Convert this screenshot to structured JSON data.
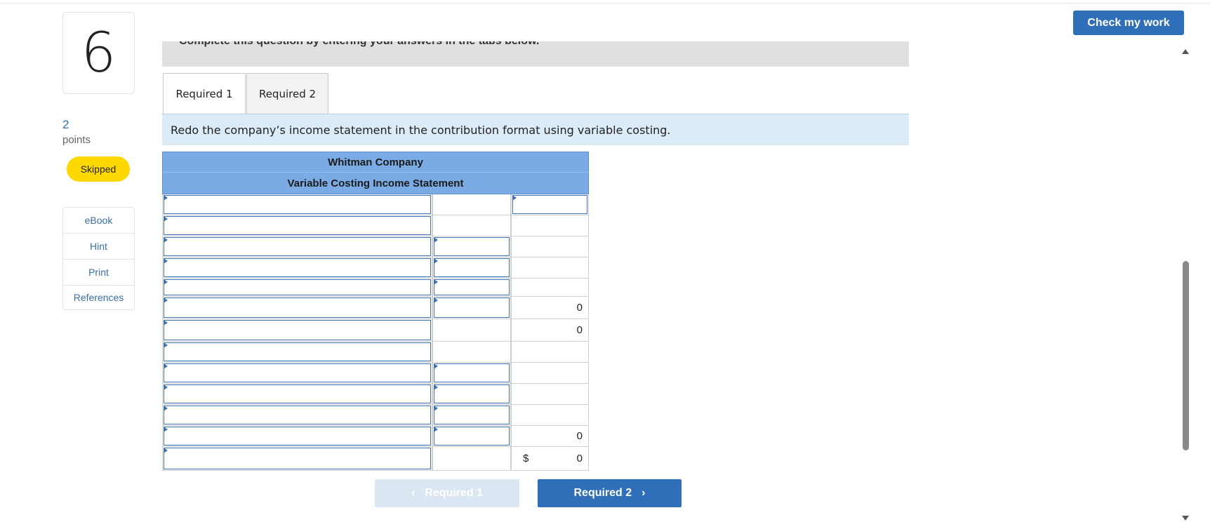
{
  "question": {
    "number": "6",
    "points_value": "2",
    "points_label": "points",
    "status": "Skipped"
  },
  "resources": [
    "eBook",
    "Hint",
    "Print",
    "References"
  ],
  "instructions_band": "Complete this question by entering your answers in the tabs below.",
  "tabs": [
    {
      "label": "Required 1",
      "active": true
    },
    {
      "label": "Required 2",
      "active": false
    }
  ],
  "prompt": "Redo the company’s income statement in the contribution format using variable costing.",
  "statement": {
    "company": "Whitman Company",
    "title": "Variable Costing Income Statement",
    "rows": [
      {
        "label_input": true,
        "mid_input": false,
        "right_input": true,
        "right_value": "",
        "dollar": false
      },
      {
        "label_input": true,
        "mid_input": false,
        "right_input": false,
        "right_value": "",
        "dollar": false
      },
      {
        "label_input": true,
        "mid_input": true,
        "right_input": false,
        "right_value": "",
        "dollar": false
      },
      {
        "label_input": true,
        "mid_input": true,
        "right_input": false,
        "right_value": "",
        "dollar": false
      },
      {
        "label_input": true,
        "mid_input": true,
        "right_input": false,
        "right_value": "",
        "dollar": false
      },
      {
        "label_input": true,
        "mid_input": true,
        "right_input": false,
        "right_value": "0",
        "dollar": false
      },
      {
        "label_input": true,
        "mid_input": false,
        "right_input": false,
        "right_value": "0",
        "dollar": false
      },
      {
        "label_input": true,
        "mid_input": false,
        "right_input": false,
        "right_value": "",
        "dollar": false
      },
      {
        "label_input": true,
        "mid_input": true,
        "right_input": false,
        "right_value": "",
        "dollar": false
      },
      {
        "label_input": true,
        "mid_input": true,
        "right_input": false,
        "right_value": "",
        "dollar": false
      },
      {
        "label_input": true,
        "mid_input": true,
        "right_input": false,
        "right_value": "",
        "dollar": false
      },
      {
        "label_input": true,
        "mid_input": true,
        "right_input": false,
        "right_value": "0",
        "dollar": false
      },
      {
        "label_input": true,
        "mid_input": false,
        "right_input": false,
        "right_value": "0",
        "dollar": true,
        "dollar_sign": "$"
      }
    ]
  },
  "nav": {
    "prev_label": "Required 1",
    "next_label": "Required 2",
    "prev_chevron": "‹",
    "next_chevron": "›"
  },
  "check_button": "Check my work",
  "colors": {
    "accent": "#2f6fba",
    "header_blue": "#7aabe4",
    "skipped_badge": "#ffd800",
    "prompt_bg": "#dcebf8"
  }
}
